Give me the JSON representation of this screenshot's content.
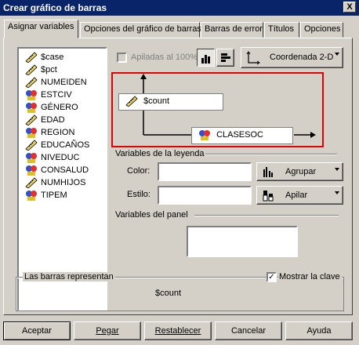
{
  "window": {
    "title": "Crear gráfico de barras",
    "close_label": "X"
  },
  "tabs": [
    {
      "label": "Asignar variables"
    },
    {
      "label": "Opciones del gráfico de barras"
    },
    {
      "label": "Barras de error"
    },
    {
      "label": "Títulos"
    },
    {
      "label": "Opciones"
    }
  ],
  "variables": [
    {
      "name": "$case",
      "type": "scale-ruler-icon"
    },
    {
      "name": "$pct",
      "type": "scale-ruler-icon"
    },
    {
      "name": "NUMEIDEN",
      "type": "scale-ruler-icon"
    },
    {
      "name": "ESTCIV",
      "type": "nominal-icon"
    },
    {
      "name": "GÉNERO",
      "type": "nominal-icon"
    },
    {
      "name": "EDAD",
      "type": "scale-ruler-icon"
    },
    {
      "name": "REGION",
      "type": "nominal-icon"
    },
    {
      "name": "EDUCAÑOS",
      "type": "scale-ruler-icon"
    },
    {
      "name": "NIVEDUC",
      "type": "nominal-icon"
    },
    {
      "name": "CONSALUD",
      "type": "nominal-icon"
    },
    {
      "name": "NUMHIJOS",
      "type": "scale-ruler-icon"
    },
    {
      "name": "TIPEM",
      "type": "nominal-icon"
    }
  ],
  "toolbar": {
    "stacked_label": "Apiladas al 100%",
    "stacked_checked": false,
    "coordinate_label": "Coordenada 2-D"
  },
  "chart_area": {
    "y_variable": "$count",
    "x_variable": "CLASESOC",
    "highlight_color": "#e00000"
  },
  "legend": {
    "group_title": "Variables de la leyenda",
    "color_label": "Color:",
    "color_value": "",
    "color_mode": "Agrupar",
    "style_label": "Estilo:",
    "style_value": "",
    "style_mode": "Apilar"
  },
  "panel": {
    "title": "Variables del panel",
    "value": ""
  },
  "bars_represent": {
    "title": "Las barras representan",
    "value": "$count",
    "show_key_label": "Mostrar la clave",
    "show_key_checked": true
  },
  "buttons": {
    "accept": "Aceptar",
    "paste": "Pegar",
    "reset": "Restablecer",
    "cancel": "Cancelar",
    "help": "Ayuda"
  }
}
